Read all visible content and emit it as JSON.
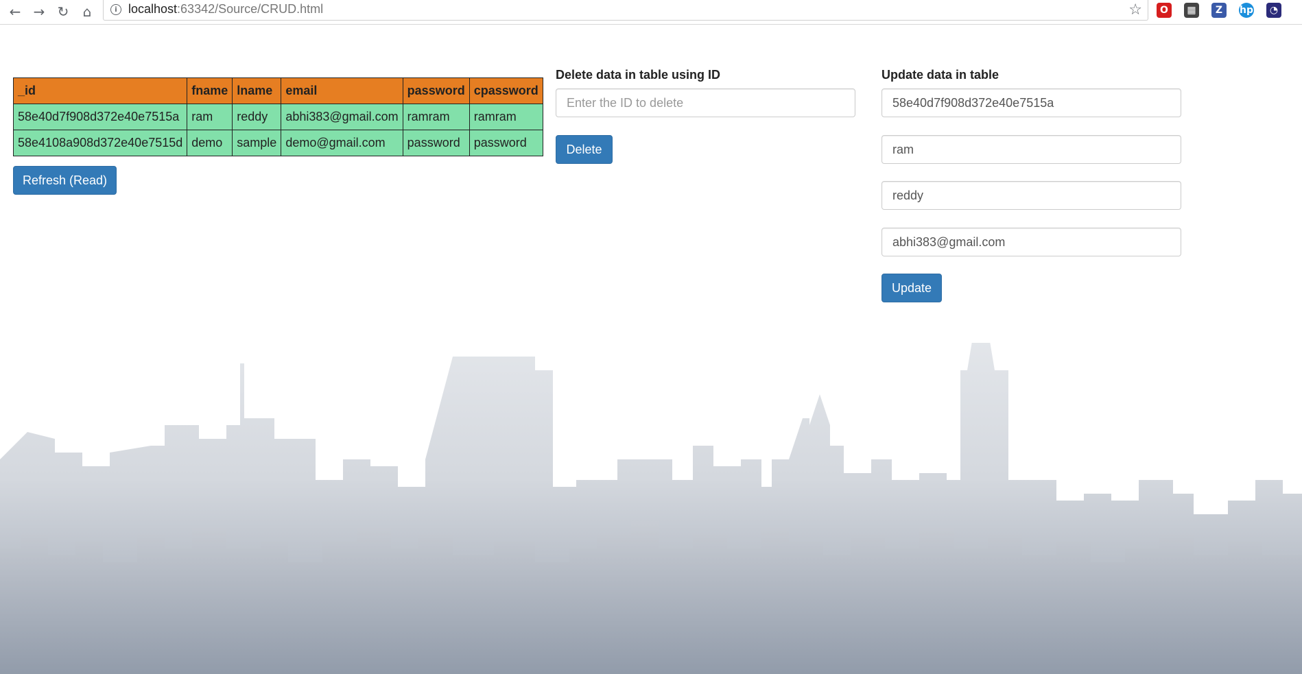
{
  "browser": {
    "url_host": "localhost",
    "url_rest": ":63342/Source/CRUD.html",
    "extensions": [
      {
        "name": "opera-icon",
        "glyph": "O",
        "color": "#d61e1e"
      },
      {
        "name": "film-icon",
        "glyph": "▦",
        "color": "#444444"
      },
      {
        "name": "z-icon",
        "glyph": "Z",
        "color": "#3a5aa8"
      },
      {
        "name": "hp-icon",
        "glyph": "hp",
        "color": "#1b8fdc"
      },
      {
        "name": "gauge-icon",
        "glyph": "◔",
        "color": "#2b2b7a"
      }
    ]
  },
  "table": {
    "headers": [
      "_id",
      "fname",
      "lname",
      "email",
      "password",
      "cpassword"
    ],
    "rows": [
      [
        "58e40d7f908d372e40e7515a",
        "ram",
        "reddy",
        "abhi383@gmail.com",
        "ramram",
        "ramram"
      ],
      [
        "58e4108a908d372e40e7515d",
        "demo",
        "sample",
        "demo@gmail.com",
        "password",
        "password"
      ]
    ]
  },
  "refresh_button": "Refresh (Read)",
  "delete_section": {
    "title": "Delete data in table using ID",
    "placeholder": "Enter the ID to delete",
    "button": "Delete"
  },
  "update_section": {
    "title": "Update data in table",
    "id_value": "58e40d7f908d372e40e7515a",
    "fname_value": "ram",
    "lname_value": "reddy",
    "email_value": "abhi383@gmail.com",
    "button": "Update"
  },
  "colors": {
    "header_bg": "#e67e22",
    "row_bg": "#82e0aa",
    "button_bg": "#337ab7"
  }
}
